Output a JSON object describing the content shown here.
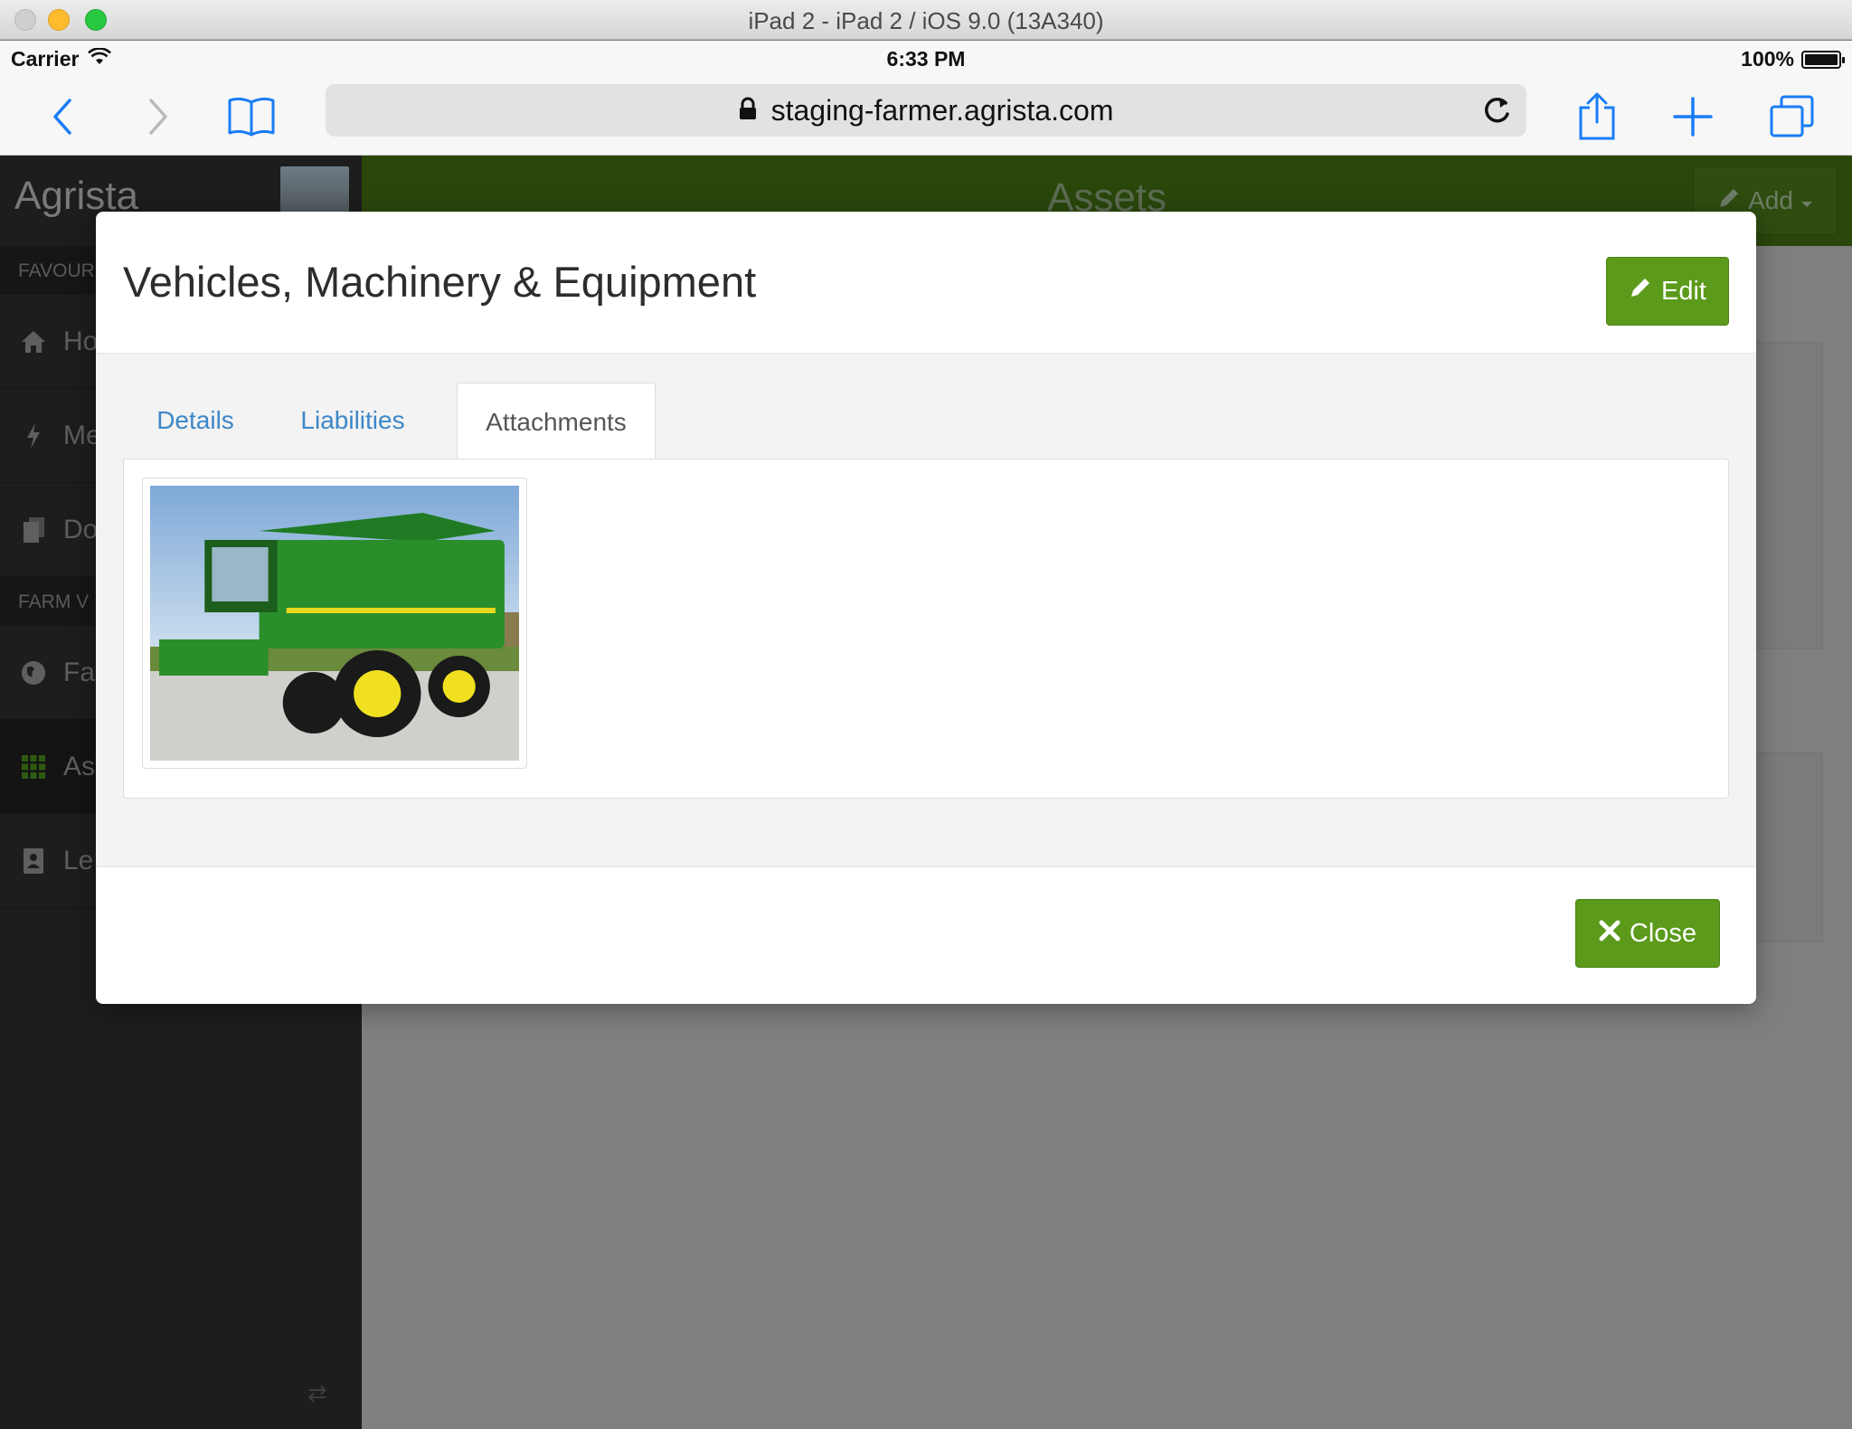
{
  "simulator": {
    "title": "iPad 2 - iPad 2 / iOS 9.0 (13A340)"
  },
  "status_bar": {
    "carrier": "Carrier",
    "time": "6:33 PM",
    "battery": "100%",
    "battery_level": 1.0
  },
  "browser": {
    "url": "staging-farmer.agrista.com"
  },
  "app": {
    "brand": "Agrista",
    "header_title": "Assets",
    "add_label": "Add",
    "sidebar": {
      "sections": [
        "FAVOUR",
        "FARM V"
      ],
      "items": [
        {
          "label": "Ho",
          "icon": "home-icon"
        },
        {
          "label": "Me",
          "icon": "bolt-icon"
        },
        {
          "label": "Do",
          "icon": "documents-icon"
        },
        {
          "label": "Fa",
          "icon": "globe-icon"
        },
        {
          "label": "As",
          "icon": "grid-icon"
        },
        {
          "label": "Le",
          "icon": "contacts-icon"
        }
      ]
    }
  },
  "modal": {
    "title": "Vehicles, Machinery & Equipment",
    "edit_label": "Edit",
    "close_label": "Close",
    "tabs": [
      {
        "label": "Details"
      },
      {
        "label": "Liabilities"
      },
      {
        "label": "Attachments"
      }
    ],
    "active_tab": "Attachments"
  },
  "colors": {
    "brand_green": "#5b9a1a",
    "header_green_dimmed": "#2a470b",
    "link_blue": "#3d87c8",
    "ios_blue": "#1a7cf5"
  }
}
